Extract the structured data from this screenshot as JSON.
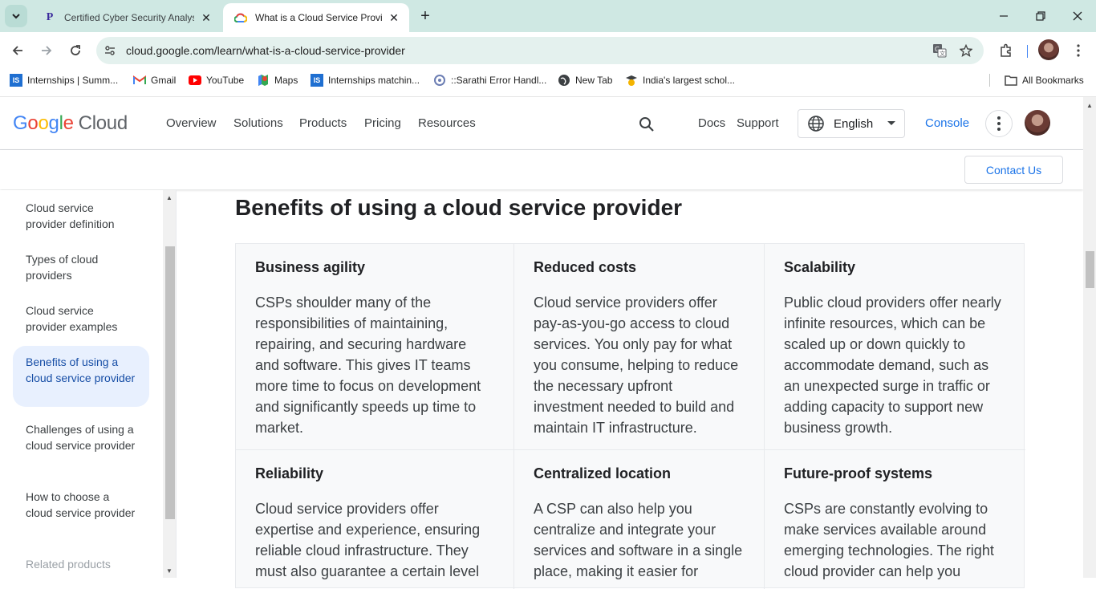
{
  "browser": {
    "tabs": [
      {
        "title": "Certified Cyber Security Analyst",
        "icon": "p-favicon"
      },
      {
        "title": "What is a Cloud Service Provider",
        "icon": "google-cloud-favicon"
      }
    ],
    "url": "cloud.google.com/learn/what-is-a-cloud-service-provider",
    "bookmarks": [
      {
        "label": "Internships | Summ...",
        "icon": "is-icon"
      },
      {
        "label": "Gmail",
        "icon": "gmail-icon"
      },
      {
        "label": "YouTube",
        "icon": "youtube-icon"
      },
      {
        "label": "Maps",
        "icon": "maps-icon"
      },
      {
        "label": "Internships matchin...",
        "icon": "is-icon"
      },
      {
        "label": "::Sarathi Error Handl...",
        "icon": "sarathi-icon"
      },
      {
        "label": "New Tab",
        "icon": "globe-icon"
      },
      {
        "label": "India's largest schol...",
        "icon": "scholar-icon"
      }
    ],
    "all_bookmarks": "All Bookmarks"
  },
  "header": {
    "logo_google": "Google",
    "logo_cloud": "Cloud",
    "nav": [
      "Overview",
      "Solutions",
      "Products",
      "Pricing",
      "Resources"
    ],
    "docs": "Docs",
    "support": "Support",
    "language": "English",
    "console": "Console",
    "contact": "Contact Us"
  },
  "sidebar": {
    "items": [
      {
        "label": "Cloud service provider definition"
      },
      {
        "label": "Types of cloud providers"
      },
      {
        "label": "Cloud service provider examples"
      },
      {
        "label": "Benefits of using a cloud service provider"
      },
      {
        "label": "Challenges of using a cloud service provider"
      },
      {
        "label": "How to choose a cloud service provider"
      },
      {
        "label": "Related products"
      }
    ],
    "active_index": 3
  },
  "main": {
    "title": "Benefits of using a cloud service provider",
    "benefits": [
      {
        "title": "Business agility",
        "body": "CSPs shoulder many of the responsibilities of maintaining, repairing, and securing hardware and software. This gives IT teams more time to focus on development and significantly speeds up time to market."
      },
      {
        "title": "Reduced costs",
        "body": "Cloud service providers offer pay-as-you-go access to cloud services. You only pay for what you consume, helping to reduce the necessary upfront investment needed to build and maintain IT infrastructure."
      },
      {
        "title": "Scalability",
        "body": "Public cloud providers offer nearly infinite resources, which can be scaled up or down quickly to accommodate demand, such as an unexpected surge in traffic or adding capacity to support new business growth."
      },
      {
        "title": "Reliability",
        "body": "Cloud service providers offer expertise and experience, ensuring reliable cloud infrastructure. They must also guarantee a certain level"
      },
      {
        "title": "Centralized location",
        "body": "A CSP can also help you centralize and integrate your services and software in a single place, making it easier for"
      },
      {
        "title": "Future-proof systems",
        "body": "CSPs are constantly evolving to make services available around emerging technologies. The right cloud provider can help you"
      }
    ]
  },
  "colors": {
    "accent": "#1a73e8",
    "active_bg": "#e8f0fe",
    "tabbar": "#cfe8e3"
  }
}
